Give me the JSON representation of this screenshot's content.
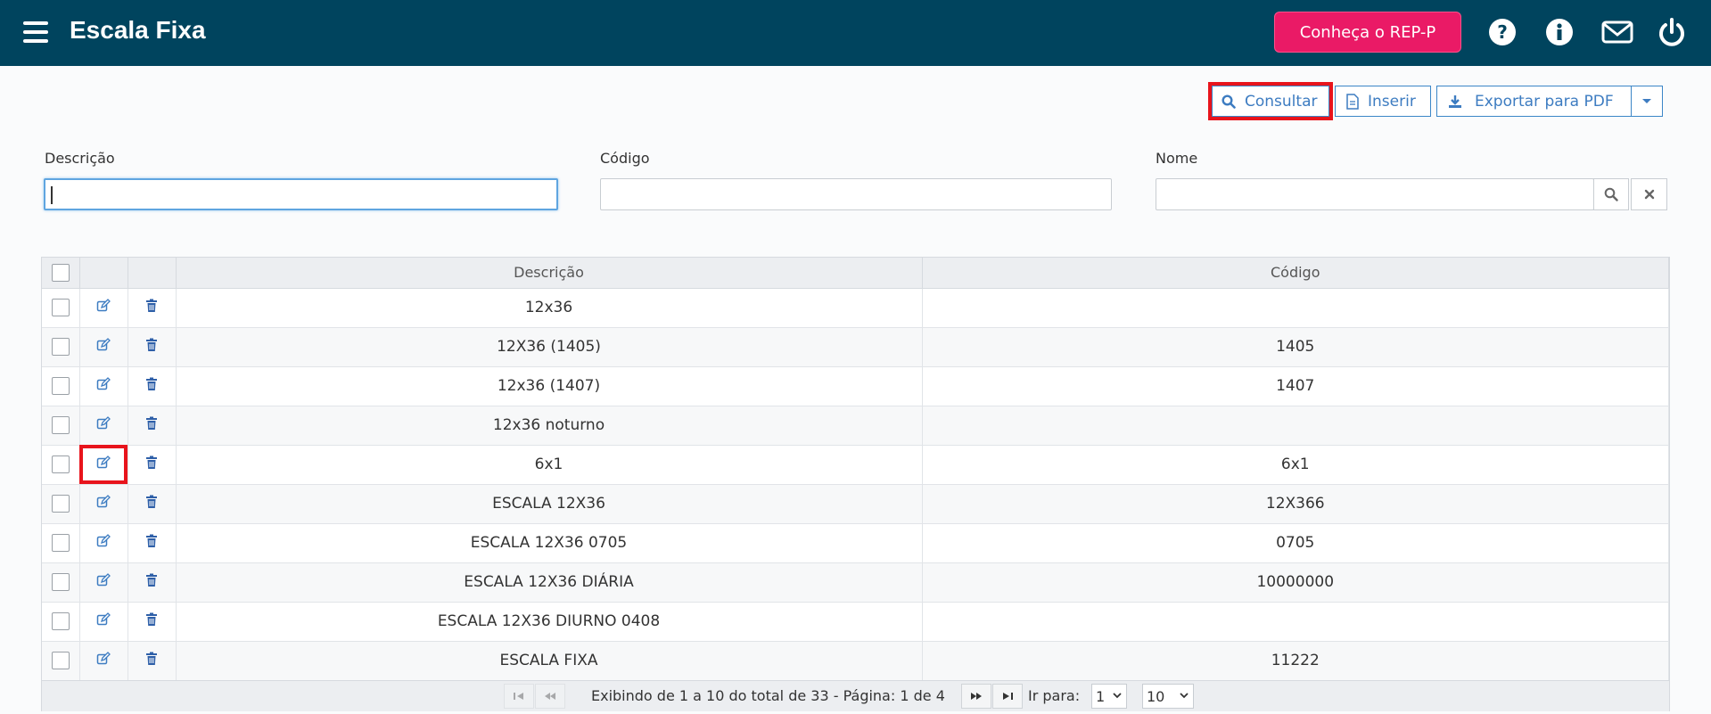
{
  "header": {
    "title": "Escala Fixa",
    "promo_button": "Conheça o REP-P",
    "icons": [
      "menu-icon",
      "help-icon",
      "info-icon",
      "mail-icon",
      "power-icon"
    ],
    "colors": {
      "bar": "#00445e",
      "promo": "#ea1a66",
      "accent": "#3d7cc1",
      "highlight": "#e8141c"
    }
  },
  "toolbar": {
    "consultar": "Consultar",
    "inserir": "Inserir",
    "exportar": "Exportar para PDF"
  },
  "filters": {
    "descricao_label": "Descrição",
    "descricao_value": "",
    "codigo_label": "Código",
    "codigo_value": "",
    "nome_label": "Nome",
    "nome_value": ""
  },
  "table": {
    "columns": [
      "Descrição",
      "Código"
    ],
    "rows": [
      {
        "descricao": "12x36",
        "codigo": ""
      },
      {
        "descricao": "12X36 (1405)",
        "codigo": "1405"
      },
      {
        "descricao": "12x36 (1407)",
        "codigo": "1407"
      },
      {
        "descricao": "12x36 noturno",
        "codigo": ""
      },
      {
        "descricao": "6x1",
        "codigo": "6x1"
      },
      {
        "descricao": "ESCALA 12X36",
        "codigo": "12X366"
      },
      {
        "descricao": "ESCALA 12X36 0705",
        "codigo": "0705"
      },
      {
        "descricao": "ESCALA 12X36 DIÁRIA",
        "codigo": "10000000"
      },
      {
        "descricao": "ESCALA 12X36 DIURNO 0408",
        "codigo": ""
      },
      {
        "descricao": "ESCALA FIXA",
        "codigo": "11222"
      }
    ]
  },
  "pager": {
    "info": "Exibindo de 1 a 10 do total de 33 - Página: 1 de 4",
    "goto_label": "Ir para:",
    "page_value": "1",
    "page_size": "10"
  }
}
